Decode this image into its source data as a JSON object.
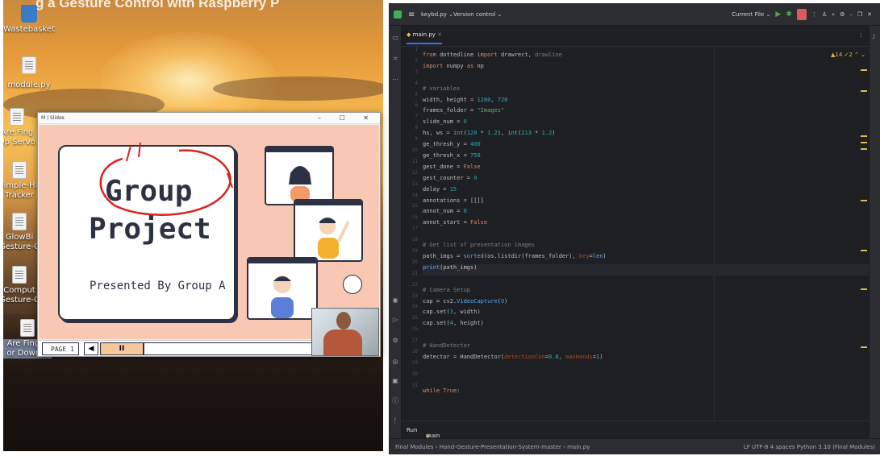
{
  "desktop": {
    "caption": "g a Gesture Control with Raspberry P",
    "icons": [
      {
        "label": "Wastebasket"
      },
      {
        "label": "module.py"
      },
      {
        "label": "Are Fing\nUp Servo"
      },
      {
        "label": "Simple-Ha\nTracker"
      },
      {
        "label": "GlowBi\nGesture-C"
      },
      {
        "label": "Comput\nGesture-C"
      },
      {
        "label": "Are Finger\nor Down.p"
      }
    ]
  },
  "slide_window": {
    "title": "M | Slides",
    "controls": "– ☐ ✕",
    "slide": {
      "title_line1": "Group",
      "title_line2": "Project",
      "subtitle": "Presented By Group A"
    },
    "bar": {
      "page": "PAGE 1",
      "prev": "◀",
      "pause": "II"
    }
  },
  "ide": {
    "project": "keybd.py ⌄",
    "vcs": "Version control ⌄",
    "run_config": "Current File ⌄",
    "tab": "main.py",
    "inspections": "▲14 ✓2 ⌃ ⌄",
    "run_tab": "Run",
    "run_target": "main",
    "breadcrumb": "Final Modules  ›  Hand-Gesture-Presentation-System-master  ›  main.py",
    "status_right": "LF   UTF-8   4 spaces   Python 3.10 (Final Modules)",
    "current_line": 20,
    "lines": [
      [
        [
          "kw",
          "from "
        ],
        [
          "t",
          "dottedline "
        ],
        [
          "kw",
          "import "
        ],
        [
          "t",
          "drawrect, "
        ],
        [
          "cmt",
          "drawline"
        ]
      ],
      [
        [
          "kw",
          "import "
        ],
        [
          "t",
          "numpy "
        ],
        [
          "kw",
          "as "
        ],
        [
          "t",
          "np"
        ]
      ],
      [],
      [
        [
          "cmt",
          "# variables"
        ]
      ],
      [
        [
          "t",
          "width, height = "
        ],
        [
          "num",
          "1280"
        ],
        [
          "t",
          ", "
        ],
        [
          "num",
          "720"
        ]
      ],
      [
        [
          "t",
          "frames_folder = "
        ],
        [
          "str",
          "\"Images\""
        ]
      ],
      [
        [
          "t",
          "slide_num = "
        ],
        [
          "num",
          "0"
        ]
      ],
      [
        [
          "t",
          "hs, ws = "
        ],
        [
          "fn",
          "int"
        ],
        [
          "t",
          "("
        ],
        [
          "num",
          "120"
        ],
        [
          "t",
          " * "
        ],
        [
          "num",
          "1.2"
        ],
        [
          "t",
          "), "
        ],
        [
          "fn",
          "int"
        ],
        [
          "t",
          "("
        ],
        [
          "num",
          "213"
        ],
        [
          "t",
          " * "
        ],
        [
          "num",
          "1.2"
        ],
        [
          "t",
          ")"
        ]
      ],
      [
        [
          "t",
          "ge_thresh_y = "
        ],
        [
          "num",
          "400"
        ]
      ],
      [
        [
          "t",
          "ge_thresh_x = "
        ],
        [
          "num",
          "750"
        ]
      ],
      [
        [
          "t",
          "gest_done = "
        ],
        [
          "kw",
          "False"
        ]
      ],
      [
        [
          "t",
          "gest_counter = "
        ],
        [
          "num",
          "0"
        ]
      ],
      [
        [
          "t",
          "delay = "
        ],
        [
          "num",
          "15"
        ]
      ],
      [
        [
          "t",
          "annotations = [[]]"
        ]
      ],
      [
        [
          "t",
          "annot_num = "
        ],
        [
          "num",
          "0"
        ]
      ],
      [
        [
          "t",
          "annot_start = "
        ],
        [
          "kw",
          "False"
        ]
      ],
      [],
      [
        [
          "cmt",
          "# Get list of presentation images"
        ]
      ],
      [
        [
          "t",
          "path_imgs = "
        ],
        [
          "fn",
          "sorted"
        ],
        [
          "t",
          "(os.listdir(frames_folder), "
        ],
        [
          "par",
          "key"
        ],
        [
          "t",
          "="
        ],
        [
          "fn",
          "len"
        ],
        [
          "t",
          ")"
        ]
      ],
      [
        [
          "fn",
          "print"
        ],
        [
          "t",
          "(path_imgs)"
        ]
      ],
      [],
      [
        [
          "cmt",
          "# Camera Setup"
        ]
      ],
      [
        [
          "t",
          "cap = cv2."
        ],
        [
          "fn",
          "VideoCapture"
        ],
        [
          "t",
          "("
        ],
        [
          "num",
          "0"
        ],
        [
          "t",
          ")"
        ]
      ],
      [
        [
          "t",
          "cap.set("
        ],
        [
          "num",
          "3"
        ],
        [
          "t",
          ", width)"
        ]
      ],
      [
        [
          "t",
          "cap.set("
        ],
        [
          "num",
          "4"
        ],
        [
          "t",
          ", height)"
        ]
      ],
      [],
      [
        [
          "cmt",
          "# HandDetector"
        ]
      ],
      [
        [
          "t",
          "detector = HandDetector("
        ],
        [
          "par",
          "detectionCon"
        ],
        [
          "t",
          "="
        ],
        [
          "num",
          "0.8"
        ],
        [
          "t",
          ", "
        ],
        [
          "par",
          "maxHands"
        ],
        [
          "t",
          "="
        ],
        [
          "num",
          "1"
        ],
        [
          "t",
          ")"
        ]
      ],
      [],
      [],
      [
        [
          "kw",
          "while "
        ],
        [
          "kw",
          "True"
        ],
        [
          "t",
          ":"
        ]
      ]
    ]
  }
}
